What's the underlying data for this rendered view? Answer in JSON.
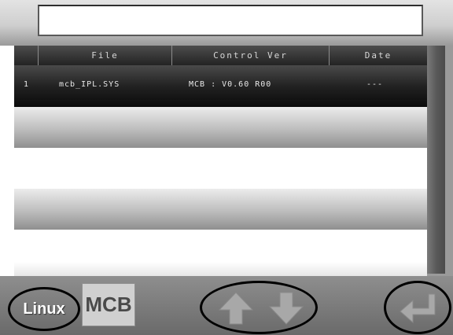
{
  "path_input": {
    "value": ""
  },
  "table": {
    "columns": [
      "",
      "File",
      "Control Ver",
      "Date"
    ],
    "rows": [
      {
        "index": "1",
        "file": "mcb_IPL.SYS",
        "control_ver": "MCB : V0.60 R00",
        "date": "---"
      }
    ]
  },
  "toolbar": {
    "linux_label": "Linux",
    "mcb_label": "MCB",
    "up_icon": "arrow-up-icon",
    "down_icon": "arrow-down-icon",
    "enter_icon": "enter-return-icon"
  },
  "colors": {
    "header_bg": "#333333",
    "selected_row_bg": "#1a1a1a",
    "toolbar_bg": "#7a7a7a",
    "arrow_color": "#9a9a9a"
  }
}
